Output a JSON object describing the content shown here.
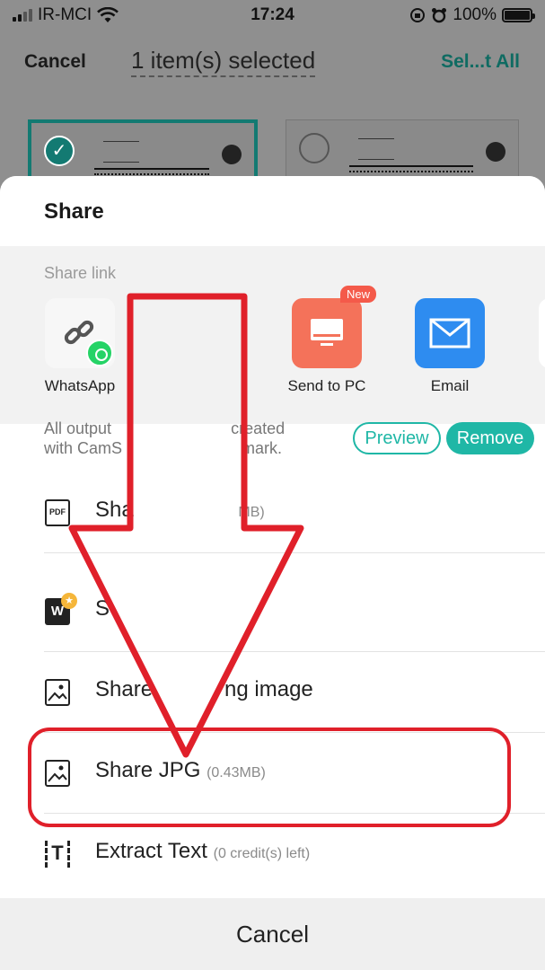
{
  "status_bar": {
    "carrier": "IR-MCI",
    "time": "17:24",
    "battery": "100%",
    "battery_level": 1.0
  },
  "nav": {
    "cancel": "Cancel",
    "title": "1 item(s) selected",
    "select_all": "Sel...t All"
  },
  "sheet": {
    "title": "Share",
    "share_link_label": "Share link",
    "targets": [
      {
        "label": "WhatsApp",
        "icon": "whatsapp-icon"
      },
      {
        "label": "Send to PC",
        "icon": "monitor-icon",
        "badge": "New"
      },
      {
        "label": "Email",
        "icon": "mail-icon"
      }
    ],
    "watermark_text_left": "All output",
    "watermark_text_right": "created",
    "watermark_line2_left": "with CamS",
    "watermark_line2_right": "mark.",
    "preview": "Preview",
    "remove": "Remove",
    "options": [
      {
        "label": "Sha",
        "meta": "MB)",
        "icon": "pdf-icon"
      },
      {
        "label": "S",
        "meta": "",
        "icon": "word-icon"
      },
      {
        "label": "Share",
        "label2": "ng image",
        "icon": "image-icon"
      },
      {
        "label": "Share JPG",
        "meta": "(0.43MB)",
        "icon": "image-icon"
      },
      {
        "label": "Extract Text",
        "meta": "(0 credit(s) left)",
        "icon": "text-scan-icon"
      }
    ],
    "cancel": "Cancel"
  },
  "colors": {
    "accent": "#1fb7a6",
    "annotation": "#e0202a"
  }
}
